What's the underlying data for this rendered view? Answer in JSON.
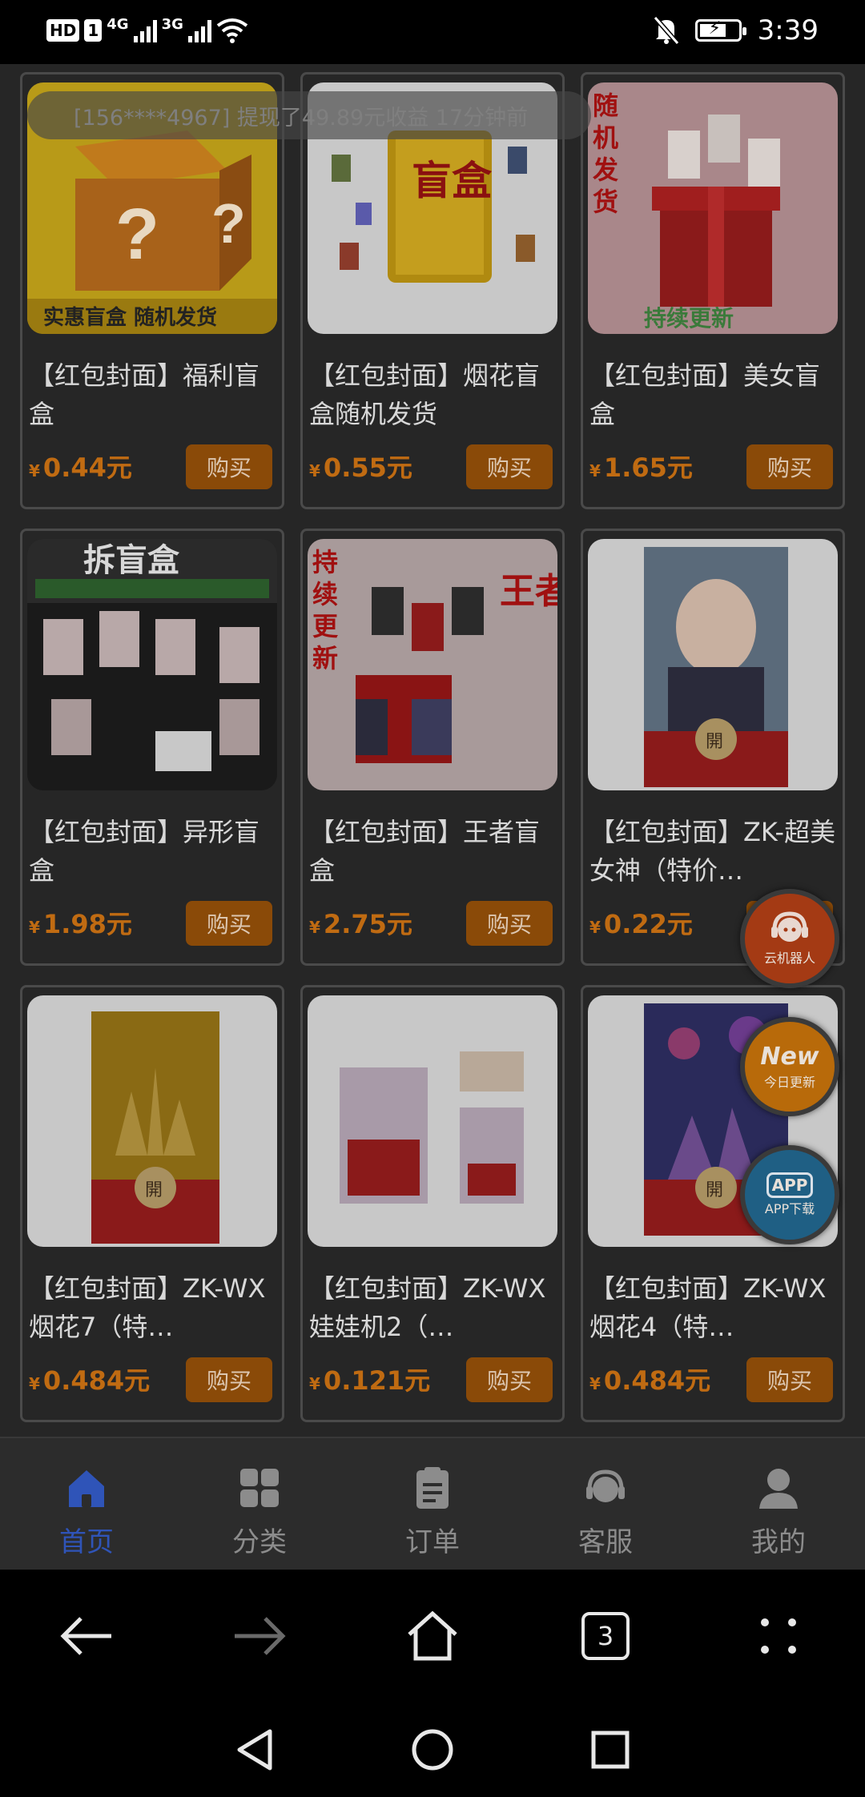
{
  "status_bar": {
    "hd_badge": "HD",
    "sim_badge": "1",
    "net1": "4G",
    "net2": "3G",
    "time": "3:39"
  },
  "ticker": "[156****4967] 提现了49.89元收益 17分钟前",
  "products": [
    {
      "title": "【红包封面】福利盲盒",
      "price": "0.44元",
      "buy": "购买",
      "img_caption": "实惠盲盒 随机发货"
    },
    {
      "title": "【红包封面】烟花盲盒随机发货",
      "price": "0.55元",
      "buy": "购买",
      "img_caption": "盲盒"
    },
    {
      "title": "【红包封面】美女盲盒",
      "price": "1.65元",
      "buy": "购买",
      "img_caption": "持续更新"
    },
    {
      "title": "【红包封面】异形盲盒",
      "price": "1.98元",
      "buy": "购买",
      "img_caption": "拆盲盒"
    },
    {
      "title": "【红包封面】王者盲盒",
      "price": "2.75元",
      "buy": "购买",
      "img_caption": "王者"
    },
    {
      "title": "【红包封面】ZK-超美女神（特价…",
      "price": "0.22元",
      "buy": "购买",
      "img_caption": "開"
    },
    {
      "title": "【红包封面】ZK-WX烟花7（特…",
      "price": "0.484元",
      "buy": "购买",
      "img_caption": "開"
    },
    {
      "title": "【红包封面】ZK-WX娃娃机2（…",
      "price": "0.121元",
      "buy": "购买",
      "img_caption": ""
    },
    {
      "title": "【红包封面】ZK-WX烟花4（特…",
      "price": "0.484元",
      "buy": "购买",
      "img_caption": "開"
    }
  ],
  "currency_symbol": "¥",
  "floating": {
    "robot_label": "云机器人",
    "new_icon_text": "New",
    "new_label": "今日更新",
    "app_icon_text": "APP",
    "app_label": "APP下载"
  },
  "tabs": [
    {
      "label": "首页",
      "icon": "home-icon",
      "active": true
    },
    {
      "label": "分类",
      "icon": "category-icon",
      "active": false
    },
    {
      "label": "订单",
      "icon": "order-icon",
      "active": false
    },
    {
      "label": "客服",
      "icon": "support-icon",
      "active": false
    },
    {
      "label": "我的",
      "icon": "profile-icon",
      "active": false
    }
  ],
  "browser": {
    "tab_count": "3"
  },
  "colors": {
    "accent": "#2f54b8",
    "price": "#c06b12",
    "buy_button": "#8a4a08"
  }
}
